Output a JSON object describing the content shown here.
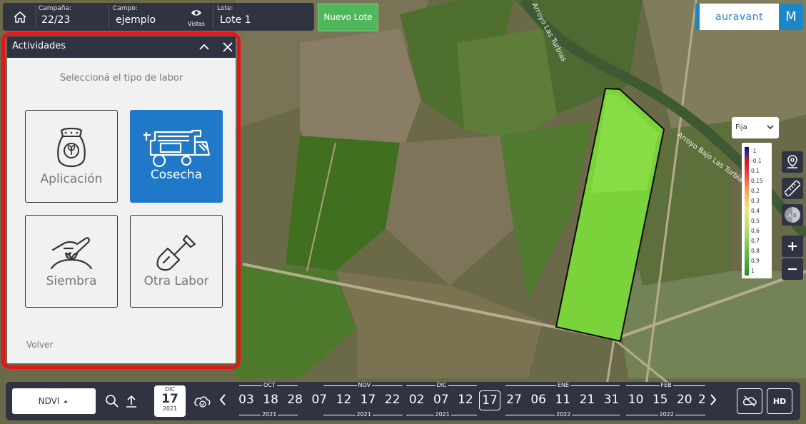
{
  "header": {
    "campaign_label": "Campaña:",
    "campaign_value": "22/23",
    "field_label": "Campo:",
    "field_value": "ejemplo",
    "views_label": "Vistas",
    "lot_label": "Lote:",
    "lot_value": "Lote 1",
    "new_lot_label": "Nuevo Lote",
    "brand": "auravant",
    "user_initial": "M"
  },
  "map": {
    "labels": [
      "Arroyo Las Turbias",
      "Arroyo Bajo Las Turbias"
    ]
  },
  "panel": {
    "title": "Actividades",
    "subtitle": "Seleccioná el tipo de labor",
    "tiles": [
      {
        "label": "Aplicación",
        "icon": "fertilizer-bag-icon",
        "active": false
      },
      {
        "label": "Cosecha",
        "icon": "harvester-icon",
        "active": true
      },
      {
        "label": "Siembra",
        "icon": "sowing-hand-icon",
        "active": false
      },
      {
        "label": "Otra Labor",
        "icon": "shovel-icon",
        "active": false
      }
    ],
    "back_label": "Volver"
  },
  "legend": {
    "mode": "Fija",
    "ticks": [
      "-1",
      "-0,1",
      "0,1",
      "0,15",
      "0,2",
      "0,3",
      "0,4",
      "0,5",
      "0,6",
      "0,7",
      "0,8",
      "0,9",
      "1"
    ]
  },
  "tools": [
    "location-pin-icon",
    "ruler-icon",
    "compare-ab-icon",
    "zoom-in-icon",
    "zoom-out-icon"
  ],
  "bottom": {
    "layer": "NDVI",
    "selected_date": {
      "month": "DIC",
      "day": "17",
      "year": "2021"
    },
    "months": [
      {
        "label": "OCT",
        "year": "2021"
      },
      {
        "label": "NOV",
        "year": "2021"
      },
      {
        "label": "DIC",
        "year": "2021"
      },
      {
        "label": "ENE",
        "year": "2022"
      },
      {
        "label": "FEB",
        "year": "2022"
      }
    ],
    "days": [
      "03",
      "18",
      "28",
      "07",
      "12",
      "17",
      "22",
      "02",
      "07",
      "12",
      "17",
      "27",
      "06",
      "11",
      "21",
      "31",
      "10",
      "15",
      "20",
      "2"
    ],
    "selected_day_index": 10,
    "hd_label": "HD"
  }
}
